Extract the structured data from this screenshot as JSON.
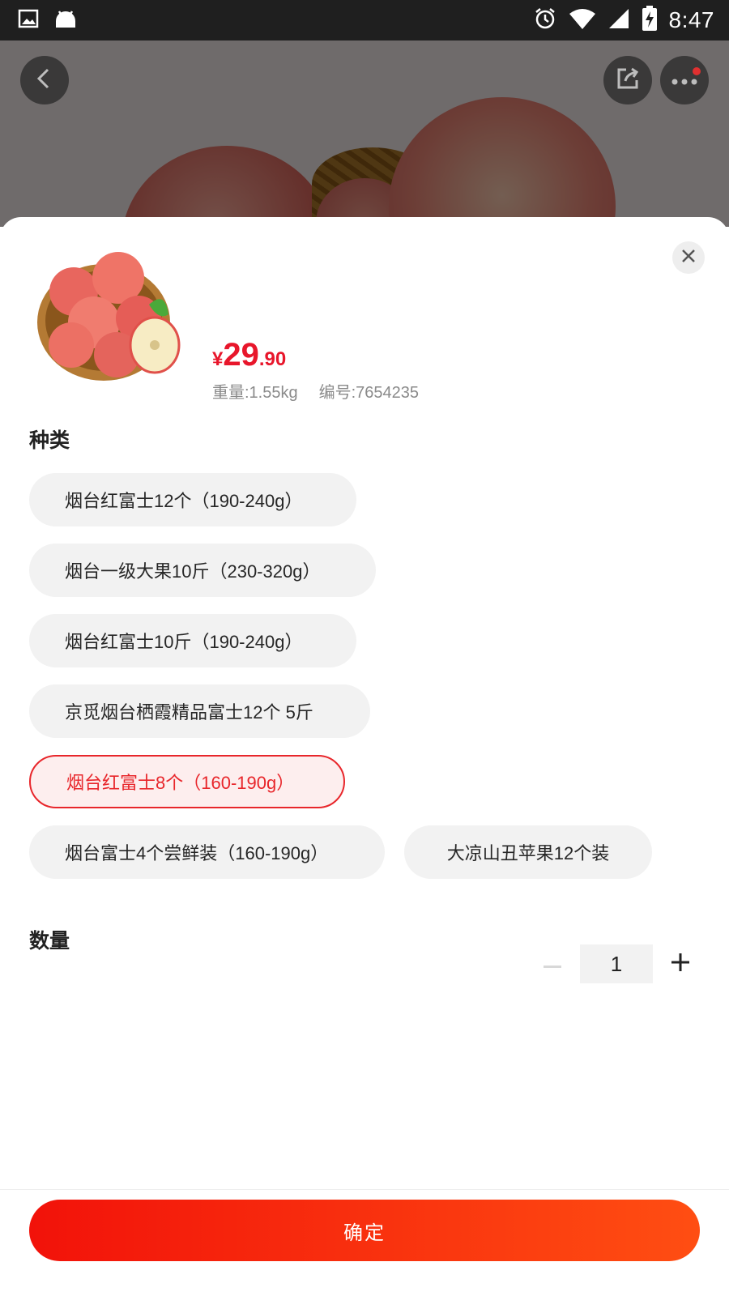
{
  "status_bar": {
    "time": "8:47",
    "icons": [
      "gallery-icon",
      "android-icon",
      "alarm-icon",
      "wifi-icon",
      "signal-icon",
      "battery-charging-icon"
    ]
  },
  "hero": {
    "buttons": [
      "back-icon",
      "share-icon",
      "more-icon"
    ],
    "notification_dot_color": "#e03030"
  },
  "product": {
    "price_currency": "¥",
    "price_integer": "29",
    "price_decimal": ".90",
    "weight": "重量:1.55kg",
    "sku": "编号:7654235"
  },
  "variant_section": {
    "title": "种类",
    "options": [
      {
        "label": "烟台红富士12个（190-240g）",
        "selected": false
      },
      {
        "label": "烟台一级大果10斤（230-320g）",
        "selected": false
      },
      {
        "label": "烟台红富士10斤（190-240g）",
        "selected": false
      },
      {
        "label": "京觅烟台栖霞精品富士12个 5斤",
        "selected": false
      },
      {
        "label": "烟台红富士8个（160-190g）",
        "selected": true
      },
      {
        "label": "烟台富士4个尝鲜装（160-190g）",
        "selected": false
      },
      {
        "label": "大凉山丑苹果12个装",
        "selected": false
      }
    ]
  },
  "quantity_section": {
    "title": "数量",
    "value": "1"
  },
  "confirm_button": {
    "label": "确定"
  },
  "colors": {
    "accent": "#e8162b",
    "chip_bg": "#f2f2f2",
    "selected_chip_bg": "#fdeeee",
    "confirm_gradient_start": "#f2120a",
    "confirm_gradient_end": "#ff4e12"
  }
}
